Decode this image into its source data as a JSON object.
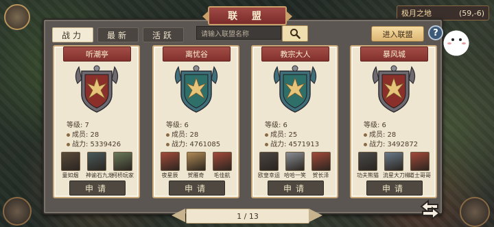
{
  "map": {
    "name": "极月之地",
    "coords": "(59,-6)"
  },
  "title": "联 盟",
  "tabs": [
    {
      "label": "战力",
      "active": true
    },
    {
      "label": "最新",
      "active": false
    },
    {
      "label": "活跃",
      "active": false
    }
  ],
  "search": {
    "placeholder": "请输入联盟名称"
  },
  "join_label": "进入联盟",
  "help_label": "?",
  "cards": [
    {
      "name": "听潮亭",
      "banner": "red",
      "level": "等级: 7",
      "members": "成员: 28",
      "power": "战力: 5339426",
      "members_list": [
        {
          "name": "童如烟",
          "color": "#5a4a3a"
        },
        {
          "name": "神谕石九龙",
          "color": "#4a5a5a"
        },
        {
          "name": "柯桥玩家",
          "color": "#6a7a5a"
        }
      ],
      "apply_label": "申请"
    },
    {
      "name": "离忧谷",
      "banner": "teal",
      "level": "等级: 6",
      "members": "成员: 28",
      "power": "战力: 4761085",
      "members_list": [
        {
          "name": "夜星辰",
          "color": "#a34a3a"
        },
        {
          "name": "贺雁奇",
          "color": "#b08a55"
        },
        {
          "name": "毛佳航",
          "color": "#a34a3a"
        }
      ],
      "apply_label": "申请"
    },
    {
      "name": "教宗大人",
      "banner": "teal",
      "level": "等级: 6",
      "members": "成员: 25",
      "power": "战力: 4571913",
      "members_list": [
        {
          "name": "欧皇幸运",
          "color": "#4a4540"
        },
        {
          "name": "哈哈一笑",
          "color": "#8a8f95"
        },
        {
          "name": "贺长泽",
          "color": "#a34a3a"
        }
      ],
      "apply_label": "申请"
    },
    {
      "name": "暴风城",
      "banner": "red",
      "level": "等级: 6",
      "members": "成员: 28",
      "power": "战力: 3492872",
      "members_list": [
        {
          "name": "功夫熊猫",
          "color": "#4a4a4a"
        },
        {
          "name": "流星大刀柳",
          "color": "#6a7a8a"
        },
        {
          "name": "道士哥哥",
          "color": "#a34a3a"
        }
      ],
      "apply_label": "申请"
    }
  ],
  "pager": "1 / 13",
  "colors": {
    "banner_red": "#8b2f2b",
    "banner_teal": "#2f6f6a",
    "accent_gold": "#c9a06a"
  }
}
